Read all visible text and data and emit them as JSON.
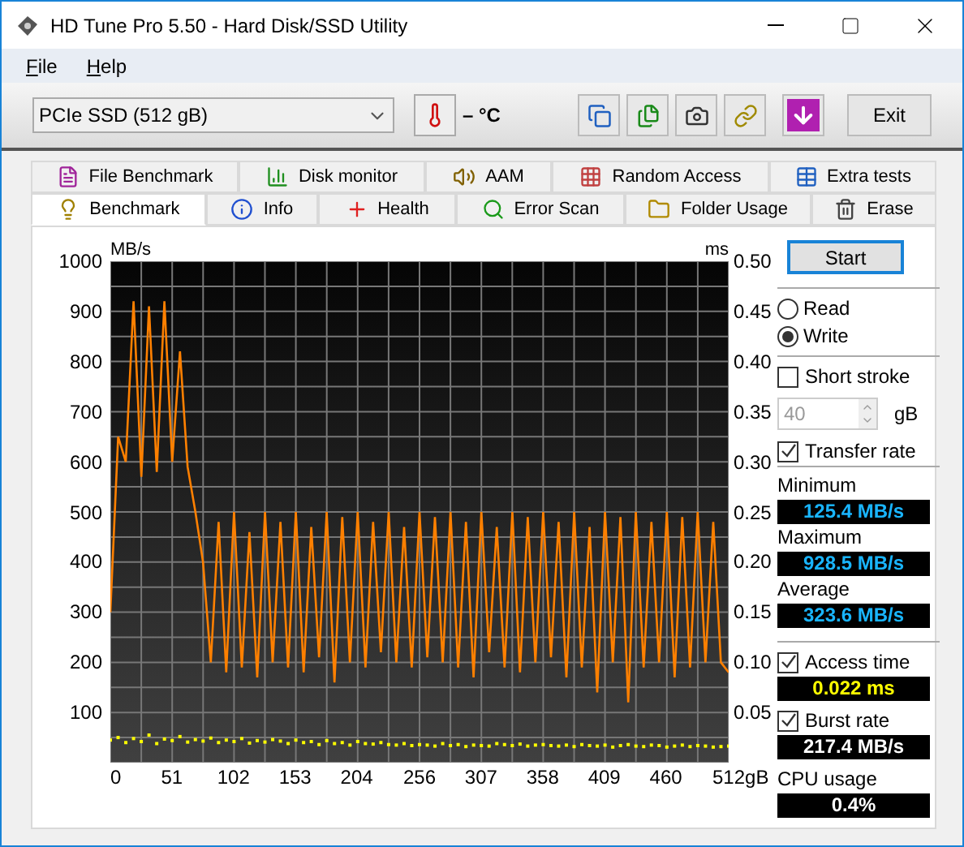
{
  "window": {
    "title": "HD Tune Pro 5.50 - Hard Disk/SSD Utility"
  },
  "menu": [
    {
      "label": "File"
    },
    {
      "label": "Help"
    }
  ],
  "toolbar": {
    "drive": "PCIe SSD (512 gB)",
    "temperature": "– °C",
    "exit": "Exit"
  },
  "tabs_top": [
    {
      "label": "File Benchmark",
      "kind": "filebench",
      "selected": false
    },
    {
      "label": "Disk monitor",
      "kind": "monitor",
      "selected": false
    },
    {
      "label": "AAM",
      "kind": "aam",
      "selected": false
    },
    {
      "label": "Random Access",
      "kind": "random",
      "selected": false
    },
    {
      "label": "Extra tests",
      "kind": "extra",
      "selected": false
    }
  ],
  "tabs_bottom": [
    {
      "label": "Benchmark",
      "kind": "bench",
      "selected": true
    },
    {
      "label": "Info",
      "kind": "info",
      "selected": false
    },
    {
      "label": "Health",
      "kind": "health",
      "selected": false
    },
    {
      "label": "Error Scan",
      "kind": "scan",
      "selected": false
    },
    {
      "label": "Folder Usage",
      "kind": "folder",
      "selected": false
    },
    {
      "label": "Erase",
      "kind": "erase",
      "selected": false
    }
  ],
  "chart": {
    "right_unit": "ms",
    "right_ticks": [
      "0.50",
      "0.45",
      "0.40",
      "0.35",
      "0.30",
      "0.25",
      "0.20",
      "0.15",
      "0.10",
      "0.05"
    ],
    "chart_data": {
      "type": "line",
      "ylabel": "MB/s",
      "grid": true,
      "xlim": [
        0,
        512
      ],
      "ylim": [
        0,
        1000
      ],
      "x": [
        0,
        6.4,
        12.8,
        19.2,
        25.6,
        32,
        38.4,
        44.8,
        51.2,
        57.6,
        64,
        70.4,
        76.8,
        83.2,
        89.6,
        96,
        102.4,
        108.8,
        115.2,
        121.6,
        128,
        134.4,
        140.8,
        147.2,
        153.6,
        160,
        166.4,
        172.8,
        179.2,
        185.6,
        192,
        198.4,
        204.8,
        211.2,
        217.6,
        224,
        230.4,
        236.8,
        243.2,
        249.6,
        256,
        262.4,
        268.8,
        275.2,
        281.6,
        288,
        294.4,
        300.8,
        307.2,
        313.6,
        320,
        326.4,
        332.8,
        339.2,
        345.6,
        352,
        358.4,
        364.8,
        371.2,
        377.6,
        384,
        390.4,
        396.8,
        403.2,
        409.6,
        416,
        422.4,
        428.8,
        435.2,
        441.6,
        448,
        454.4,
        460.8,
        467.2,
        473.6,
        480,
        486.4,
        492.8,
        499.2,
        505.6,
        512
      ],
      "xticks": [
        0,
        51,
        102,
        153,
        204,
        256,
        307,
        358,
        409,
        460,
        {
          "value": 512,
          "label": "512gB"
        }
      ],
      "yticks": [
        100,
        200,
        300,
        400,
        500,
        600,
        700,
        800,
        900,
        1000
      ],
      "series": [
        {
          "color": "#ff8000",
          "values": [
            300,
            650,
            600,
            920,
            570,
            910,
            580,
            920,
            600,
            820,
            590,
            500,
            400,
            200,
            480,
            180,
            500,
            190,
            460,
            170,
            500,
            200,
            480,
            190,
            500,
            180,
            470,
            210,
            500,
            160,
            490,
            200,
            500,
            190,
            480,
            220,
            500,
            200,
            470,
            190,
            500,
            210,
            490,
            200,
            500,
            190,
            480,
            170,
            500,
            220,
            470,
            190,
            500,
            180,
            490,
            200,
            500,
            210,
            480,
            170,
            500,
            190,
            470,
            140,
            500,
            200,
            490,
            120,
            500,
            190,
            480,
            200,
            500,
            170,
            490,
            190,
            500,
            200,
            480,
            200,
            180
          ]
        },
        {
          "type": "scatter",
          "color": "#ffff00",
          "values": [
            45,
            50,
            40,
            48,
            42,
            55,
            38,
            47,
            44,
            52,
            41,
            46,
            43,
            49,
            40,
            45,
            42,
            48,
            39,
            44,
            41,
            46,
            43,
            38,
            45,
            40,
            42,
            36,
            44,
            38,
            40,
            35,
            42,
            38,
            37,
            40,
            36,
            35,
            38,
            34,
            36,
            35,
            33,
            38,
            34,
            36,
            32,
            35,
            34,
            33,
            38,
            36,
            34,
            37,
            33,
            35,
            36,
            34,
            33,
            35,
            32,
            36,
            34,
            33,
            35,
            31,
            34,
            36,
            33,
            32,
            35,
            34,
            31,
            33,
            35,
            32,
            34,
            33,
            31,
            32,
            33
          ]
        }
      ]
    }
  },
  "side": {
    "start": "Start",
    "modes": [
      {
        "label": "Read",
        "selected": false
      },
      {
        "label": "Write",
        "selected": true
      }
    ],
    "short_stroke": {
      "label": "Short stroke",
      "checked": false
    },
    "stroke_size": {
      "value": "40",
      "disabled": true
    },
    "stroke_unit": "gB",
    "transfer_rate": {
      "label": "Transfer rate",
      "checked": true
    },
    "readouts": [
      {
        "label": "Minimum",
        "value": "125.4 MB/s"
      },
      {
        "label": "Maximum",
        "value": "928.5 MB/s"
      },
      {
        "label": "Average",
        "value": "323.6 MB/s"
      }
    ],
    "access_time": {
      "label": "Access time",
      "checked": true,
      "value": "0.022 ms"
    },
    "burst_rate": {
      "label": "Burst rate",
      "checked": true,
      "value": "217.4 MB/s"
    },
    "cpu": {
      "label": "CPU usage",
      "value": "0.4%"
    }
  }
}
